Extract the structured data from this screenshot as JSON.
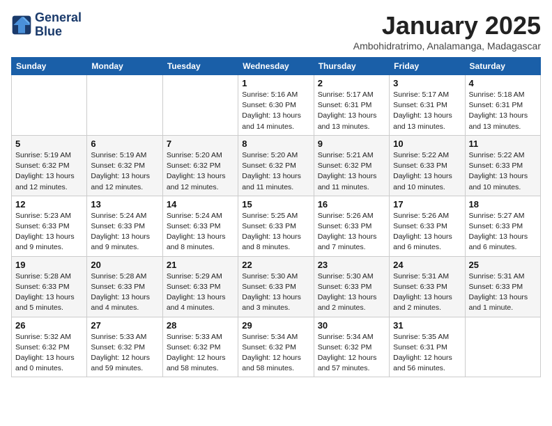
{
  "logo": {
    "line1": "General",
    "line2": "Blue"
  },
  "title": "January 2025",
  "subtitle": "Ambohidratrimo, Analamanga, Madagascar",
  "weekdays": [
    "Sunday",
    "Monday",
    "Tuesday",
    "Wednesday",
    "Thursday",
    "Friday",
    "Saturday"
  ],
  "weeks": [
    [
      {
        "day": "",
        "info": ""
      },
      {
        "day": "",
        "info": ""
      },
      {
        "day": "",
        "info": ""
      },
      {
        "day": "1",
        "info": "Sunrise: 5:16 AM\nSunset: 6:30 PM\nDaylight: 13 hours\nand 14 minutes."
      },
      {
        "day": "2",
        "info": "Sunrise: 5:17 AM\nSunset: 6:31 PM\nDaylight: 13 hours\nand 13 minutes."
      },
      {
        "day": "3",
        "info": "Sunrise: 5:17 AM\nSunset: 6:31 PM\nDaylight: 13 hours\nand 13 minutes."
      },
      {
        "day": "4",
        "info": "Sunrise: 5:18 AM\nSunset: 6:31 PM\nDaylight: 13 hours\nand 13 minutes."
      }
    ],
    [
      {
        "day": "5",
        "info": "Sunrise: 5:19 AM\nSunset: 6:32 PM\nDaylight: 13 hours\nand 12 minutes."
      },
      {
        "day": "6",
        "info": "Sunrise: 5:19 AM\nSunset: 6:32 PM\nDaylight: 13 hours\nand 12 minutes."
      },
      {
        "day": "7",
        "info": "Sunrise: 5:20 AM\nSunset: 6:32 PM\nDaylight: 13 hours\nand 12 minutes."
      },
      {
        "day": "8",
        "info": "Sunrise: 5:20 AM\nSunset: 6:32 PM\nDaylight: 13 hours\nand 11 minutes."
      },
      {
        "day": "9",
        "info": "Sunrise: 5:21 AM\nSunset: 6:32 PM\nDaylight: 13 hours\nand 11 minutes."
      },
      {
        "day": "10",
        "info": "Sunrise: 5:22 AM\nSunset: 6:33 PM\nDaylight: 13 hours\nand 10 minutes."
      },
      {
        "day": "11",
        "info": "Sunrise: 5:22 AM\nSunset: 6:33 PM\nDaylight: 13 hours\nand 10 minutes."
      }
    ],
    [
      {
        "day": "12",
        "info": "Sunrise: 5:23 AM\nSunset: 6:33 PM\nDaylight: 13 hours\nand 9 minutes."
      },
      {
        "day": "13",
        "info": "Sunrise: 5:24 AM\nSunset: 6:33 PM\nDaylight: 13 hours\nand 9 minutes."
      },
      {
        "day": "14",
        "info": "Sunrise: 5:24 AM\nSunset: 6:33 PM\nDaylight: 13 hours\nand 8 minutes."
      },
      {
        "day": "15",
        "info": "Sunrise: 5:25 AM\nSunset: 6:33 PM\nDaylight: 13 hours\nand 8 minutes."
      },
      {
        "day": "16",
        "info": "Sunrise: 5:26 AM\nSunset: 6:33 PM\nDaylight: 13 hours\nand 7 minutes."
      },
      {
        "day": "17",
        "info": "Sunrise: 5:26 AM\nSunset: 6:33 PM\nDaylight: 13 hours\nand 6 minutes."
      },
      {
        "day": "18",
        "info": "Sunrise: 5:27 AM\nSunset: 6:33 PM\nDaylight: 13 hours\nand 6 minutes."
      }
    ],
    [
      {
        "day": "19",
        "info": "Sunrise: 5:28 AM\nSunset: 6:33 PM\nDaylight: 13 hours\nand 5 minutes."
      },
      {
        "day": "20",
        "info": "Sunrise: 5:28 AM\nSunset: 6:33 PM\nDaylight: 13 hours\nand 4 minutes."
      },
      {
        "day": "21",
        "info": "Sunrise: 5:29 AM\nSunset: 6:33 PM\nDaylight: 13 hours\nand 4 minutes."
      },
      {
        "day": "22",
        "info": "Sunrise: 5:30 AM\nSunset: 6:33 PM\nDaylight: 13 hours\nand 3 minutes."
      },
      {
        "day": "23",
        "info": "Sunrise: 5:30 AM\nSunset: 6:33 PM\nDaylight: 13 hours\nand 2 minutes."
      },
      {
        "day": "24",
        "info": "Sunrise: 5:31 AM\nSunset: 6:33 PM\nDaylight: 13 hours\nand 2 minutes."
      },
      {
        "day": "25",
        "info": "Sunrise: 5:31 AM\nSunset: 6:33 PM\nDaylight: 13 hours\nand 1 minute."
      }
    ],
    [
      {
        "day": "26",
        "info": "Sunrise: 5:32 AM\nSunset: 6:32 PM\nDaylight: 13 hours\nand 0 minutes."
      },
      {
        "day": "27",
        "info": "Sunrise: 5:33 AM\nSunset: 6:32 PM\nDaylight: 12 hours\nand 59 minutes."
      },
      {
        "day": "28",
        "info": "Sunrise: 5:33 AM\nSunset: 6:32 PM\nDaylight: 12 hours\nand 58 minutes."
      },
      {
        "day": "29",
        "info": "Sunrise: 5:34 AM\nSunset: 6:32 PM\nDaylight: 12 hours\nand 58 minutes."
      },
      {
        "day": "30",
        "info": "Sunrise: 5:34 AM\nSunset: 6:32 PM\nDaylight: 12 hours\nand 57 minutes."
      },
      {
        "day": "31",
        "info": "Sunrise: 5:35 AM\nSunset: 6:31 PM\nDaylight: 12 hours\nand 56 minutes."
      },
      {
        "day": "",
        "info": ""
      }
    ]
  ]
}
